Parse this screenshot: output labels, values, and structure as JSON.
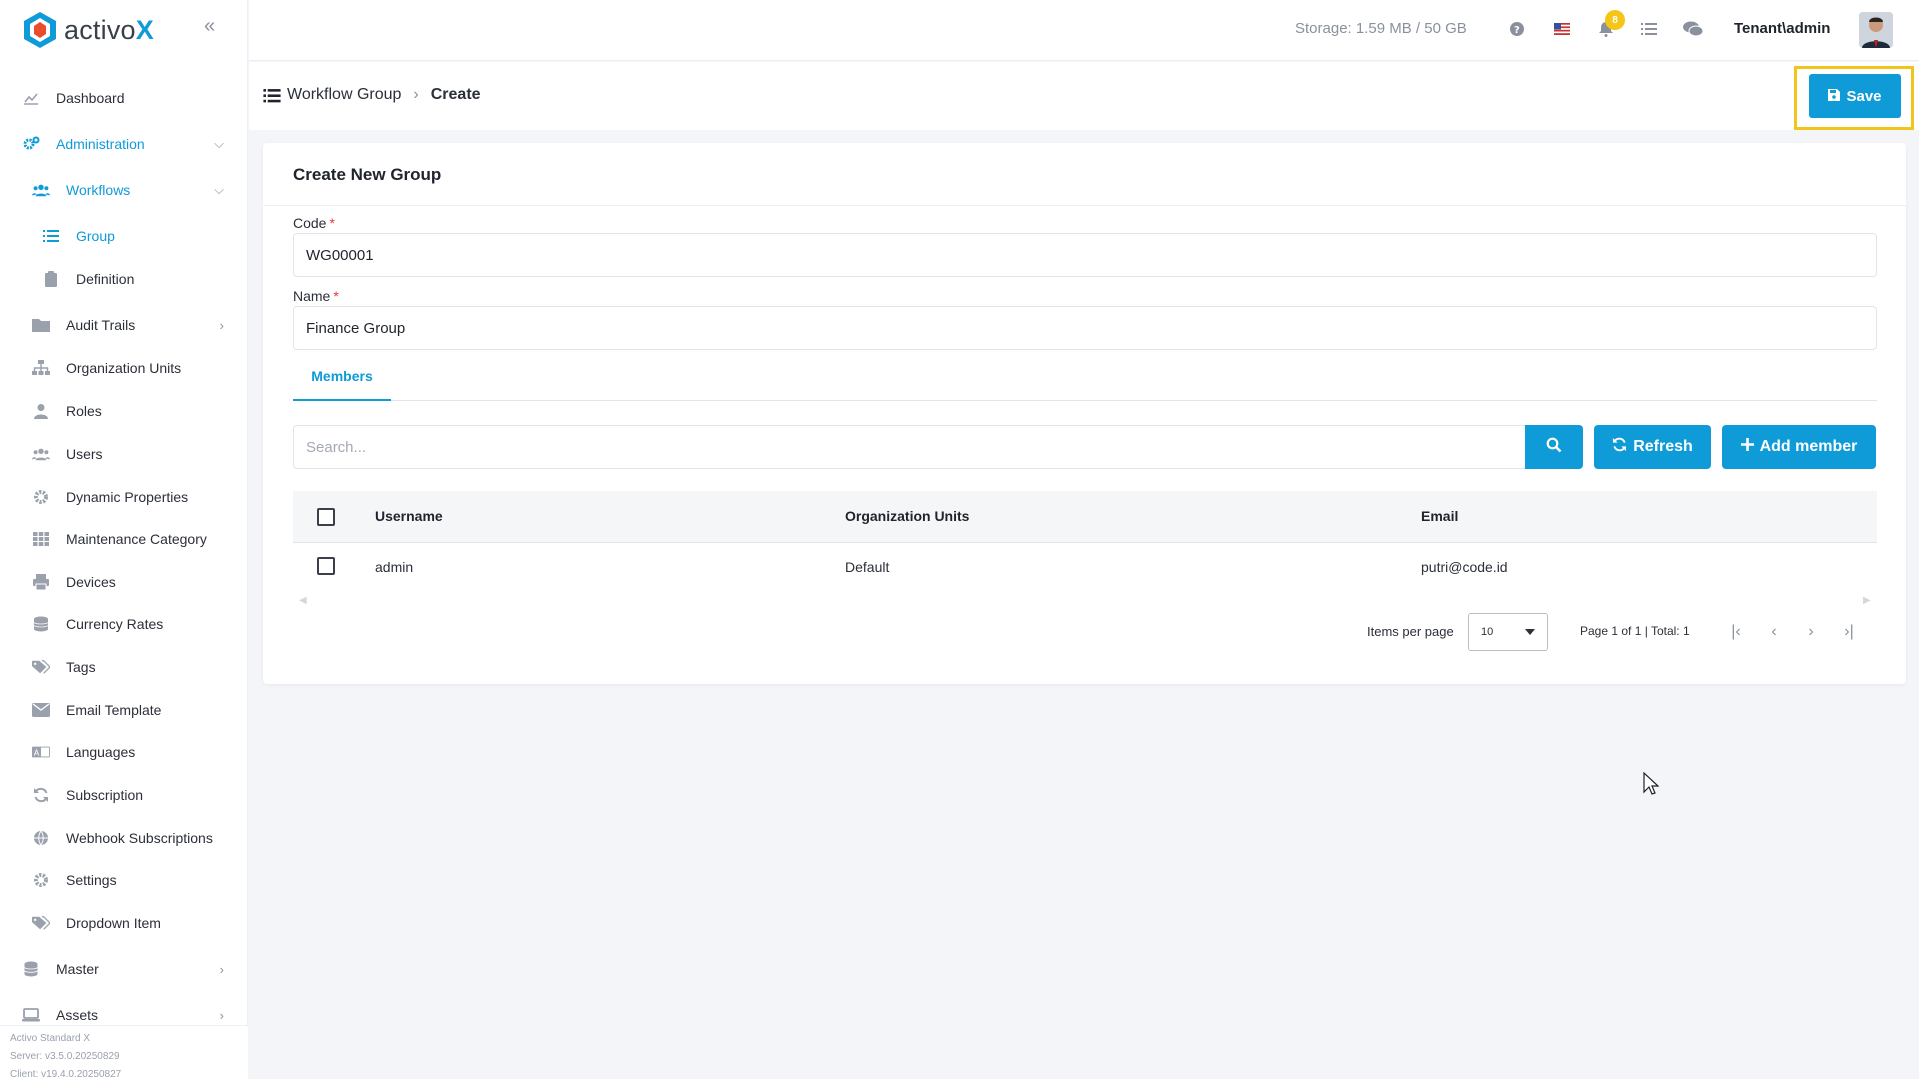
{
  "brand": {
    "name_prefix": "activo",
    "name_suffix": "X"
  },
  "sidebar": {
    "items": [
      {
        "label": "Dashboard",
        "icon": "chart-line-icon"
      },
      {
        "label": "Administration",
        "icon": "cogs-icon",
        "expanded": true
      },
      {
        "label": "Workflows",
        "icon": "users-icon",
        "expanded": true
      },
      {
        "label": "Group",
        "icon": "list-icon",
        "selected": true
      },
      {
        "label": "Definition",
        "icon": "clipboard-icon"
      },
      {
        "label": "Audit Trails",
        "icon": "folder-icon"
      },
      {
        "label": "Organization Units",
        "icon": "sitemap-icon"
      },
      {
        "label": "Roles",
        "icon": "user-tie-icon"
      },
      {
        "label": "Users",
        "icon": "users-icon"
      },
      {
        "label": "Dynamic Properties",
        "icon": "gear-icon"
      },
      {
        "label": "Maintenance Category",
        "icon": "grid-icon"
      },
      {
        "label": "Devices",
        "icon": "printer-icon"
      },
      {
        "label": "Currency Rates",
        "icon": "coins-icon"
      },
      {
        "label": "Tags",
        "icon": "tags-icon"
      },
      {
        "label": "Email Template",
        "icon": "envelope-icon"
      },
      {
        "label": "Languages",
        "icon": "language-icon"
      },
      {
        "label": "Subscription",
        "icon": "sync-icon"
      },
      {
        "label": "Webhook Subscriptions",
        "icon": "globe-icon"
      },
      {
        "label": "Settings",
        "icon": "gear-icon"
      },
      {
        "label": "Dropdown Item",
        "icon": "tags-icon"
      },
      {
        "label": "Master",
        "icon": "database-icon"
      },
      {
        "label": "Assets",
        "icon": "laptop-icon"
      }
    ],
    "version": {
      "product": "Activo Standard X",
      "server": "Server: v3.5.0.20250829",
      "client": "Client: v19.4.0.20250827"
    }
  },
  "header": {
    "storage": "Storage: 1.59 MB / 50 GB",
    "notification_count": "8",
    "user": "Tenant\\admin"
  },
  "breadcrumb": {
    "parent": "Workflow Group",
    "current": "Create"
  },
  "toolbar": {
    "save_label": "Save"
  },
  "form": {
    "title": "Create New Group",
    "code_label": "Code",
    "code_value": "WG00001",
    "name_label": "Name",
    "name_value": "Finance Group",
    "required_mark": "*"
  },
  "tabs": [
    {
      "label": "Members",
      "active": true
    }
  ],
  "members": {
    "search_placeholder": "Search...",
    "refresh_label": "Refresh",
    "add_label": "Add member",
    "columns": [
      "Username",
      "Organization Units",
      "Email"
    ],
    "rows": [
      {
        "username": "admin",
        "org_unit": "Default",
        "email": "putri@code.id"
      }
    ]
  },
  "pagination": {
    "items_per_page_label": "Items per page",
    "items_per_page": "10",
    "page_info": "Page 1 of 1 | Total: 1"
  },
  "colors": {
    "accent": "#0e9bd8",
    "highlight": "#f2c51a",
    "badge": "#f5c518"
  }
}
